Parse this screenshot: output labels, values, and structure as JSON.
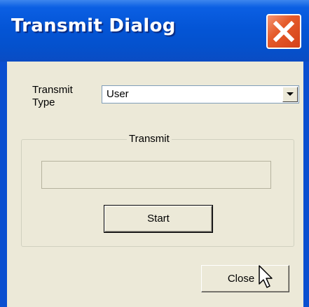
{
  "window": {
    "title": "Transmit Dialog"
  },
  "transmit_type": {
    "label_line1": "Transmit",
    "label_line2": "Type",
    "selected": "User"
  },
  "transmit_group": {
    "title": "Transmit",
    "progress": 0,
    "start_label": "Start"
  },
  "footer": {
    "close_label": "Close"
  },
  "colors": {
    "titlebar": "#0455d6",
    "dialog_bg": "#ece9d8",
    "close_button": "#e55b2b"
  },
  "icons": {
    "close": "close-x-icon",
    "dropdown": "chevron-down-icon",
    "cursor": "mouse-pointer-icon"
  }
}
